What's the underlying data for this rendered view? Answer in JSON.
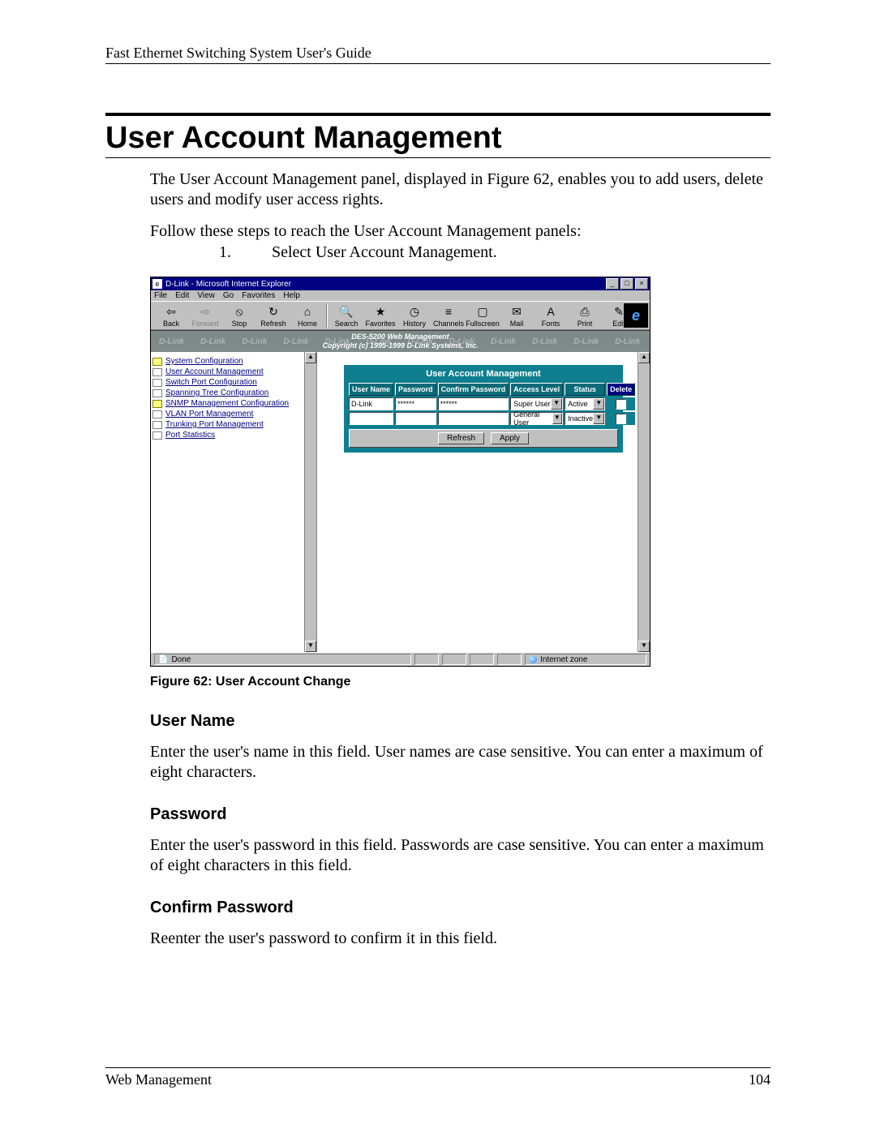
{
  "page": {
    "running_head": "Fast Ethernet Switching System User's Guide",
    "section_title": "User Account Management",
    "intro": "The User Account Management panel, displayed in Figure 62, enables you to add users, delete users and modify user access rights.",
    "lead_in": "Follow these steps to reach the User Account Management panels:",
    "step_num": "1.",
    "step_text": "Select User Account Management.",
    "fig_caption": "Figure 62: User Account Change",
    "h_user_name": "User Name",
    "p_user_name": "Enter the user's name in this field. User names are case sensitive. You can enter a maximum of eight characters.",
    "h_password": "Password",
    "p_password": "Enter the user's password in this field. Passwords are case sensitive. You can enter a maximum of eight characters in this field.",
    "h_confirm": "Confirm Password",
    "p_confirm": "Reenter the user's password to confirm it in this field.",
    "footer_left": "Web Management",
    "footer_right": "104"
  },
  "ie": {
    "title": "D-Link - Microsoft Internet Explorer",
    "menus": {
      "file": "File",
      "edit": "Edit",
      "view": "View",
      "go": "Go",
      "favorites": "Favorites",
      "help": "Help"
    },
    "toolbar": {
      "back": "Back",
      "forward": "Forward",
      "stop": "Stop",
      "refresh": "Refresh",
      "home": "Home",
      "search": "Search",
      "favorites": "Favorites",
      "history": "History",
      "channels": "Channels",
      "fullscreen": "Fullscreen",
      "mail": "Mail",
      "fonts": "Fonts",
      "print": "Print",
      "edit": "Edit"
    },
    "banner_line1": "DES-5200 Web Management",
    "banner_line2": "Copyright (c) 1995-1999 D-Link Systems, Inc.",
    "watermark": "D-Link",
    "status_done": "Done",
    "status_zone": "Internet zone"
  },
  "nav": {
    "items": [
      {
        "icon": "folder",
        "label": "System Configuration"
      },
      {
        "icon": "doc",
        "label": "User Account Management"
      },
      {
        "icon": "doc",
        "label": "Switch Port Configuration"
      },
      {
        "icon": "doc",
        "label": "Spanning Tree Configuration"
      },
      {
        "icon": "folder",
        "label": "SNMP Management Configuration"
      },
      {
        "icon": "doc",
        "label": "VLAN Port Management"
      },
      {
        "icon": "doc",
        "label": "Trunking Port Management"
      },
      {
        "icon": "doc",
        "label": "Port Statistics"
      }
    ]
  },
  "panel": {
    "title": "User Account Management",
    "headers": {
      "user": "User Name",
      "pass": "Password",
      "confirm": "Confirm Password",
      "access": "Access Level",
      "status": "Status",
      "delete": "Delete"
    },
    "rows": [
      {
        "user": "D-Link",
        "pass": "******",
        "confirm": "******",
        "access": "Super User",
        "status": "Active"
      },
      {
        "user": "",
        "pass": "",
        "confirm": "",
        "access": "General User",
        "status": "Inactive"
      }
    ],
    "refresh": "Refresh",
    "apply": "Apply"
  }
}
